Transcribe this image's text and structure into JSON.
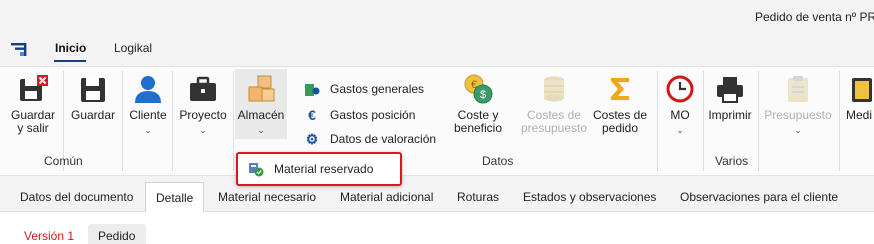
{
  "window": {
    "title": "Pedido de venta nº PR"
  },
  "menu": {
    "tabs": [
      "Inicio",
      "Logikal"
    ]
  },
  "ribbon": {
    "buttons": {
      "guardar_salir": [
        "Guardar",
        "y salir"
      ],
      "guardar": "Guardar",
      "cliente": "Cliente",
      "proyecto": "Proyecto",
      "almacen": "Almacén",
      "coste_beneficio": [
        "Coste y",
        "beneficio"
      ],
      "costes_presupuesto": [
        "Costes de",
        "presupuesto"
      ],
      "costes_pedido": [
        "Costes de",
        "pedido"
      ],
      "mo": "MO",
      "imprimir": "Imprimir",
      "presupuesto": "Presupuesto",
      "medi": "Medi"
    },
    "small_buttons": [
      "Gastos generales",
      "Gastos posición",
      "Datos de valoración"
    ],
    "groups": [
      "Común",
      "Datos",
      "Varios"
    ],
    "dropdown_item": "Material reservado",
    "icons": {
      "guardar_salir": "save-exit-icon",
      "guardar": "save-icon",
      "cliente": "person-icon",
      "proyecto": "briefcase-icon",
      "almacen": "boxes-icon",
      "gastos_generales": "money-icon",
      "gastos_posicion": "euro-icon",
      "datos_valoracion": "gear-icon",
      "coste_beneficio": "coins-icon",
      "costes_presupuesto": "stack-icon",
      "costes_pedido": "sigma-icon",
      "mo": "clock-icon",
      "imprimir": "printer-icon",
      "presupuesto": "clipboard-icon"
    }
  },
  "doc_tabs": [
    "Datos del documento",
    "Detalle",
    "Material necesario",
    "Material adicional",
    "Roturas",
    "Estados y observaciones",
    "Observaciones para el cliente"
  ],
  "sub": {
    "version": "Versión 1",
    "pill": "Pedido"
  },
  "colors": {
    "accent": "#1a3a8a",
    "highlight_border": "#e0141e",
    "version_red": "#d01818"
  }
}
